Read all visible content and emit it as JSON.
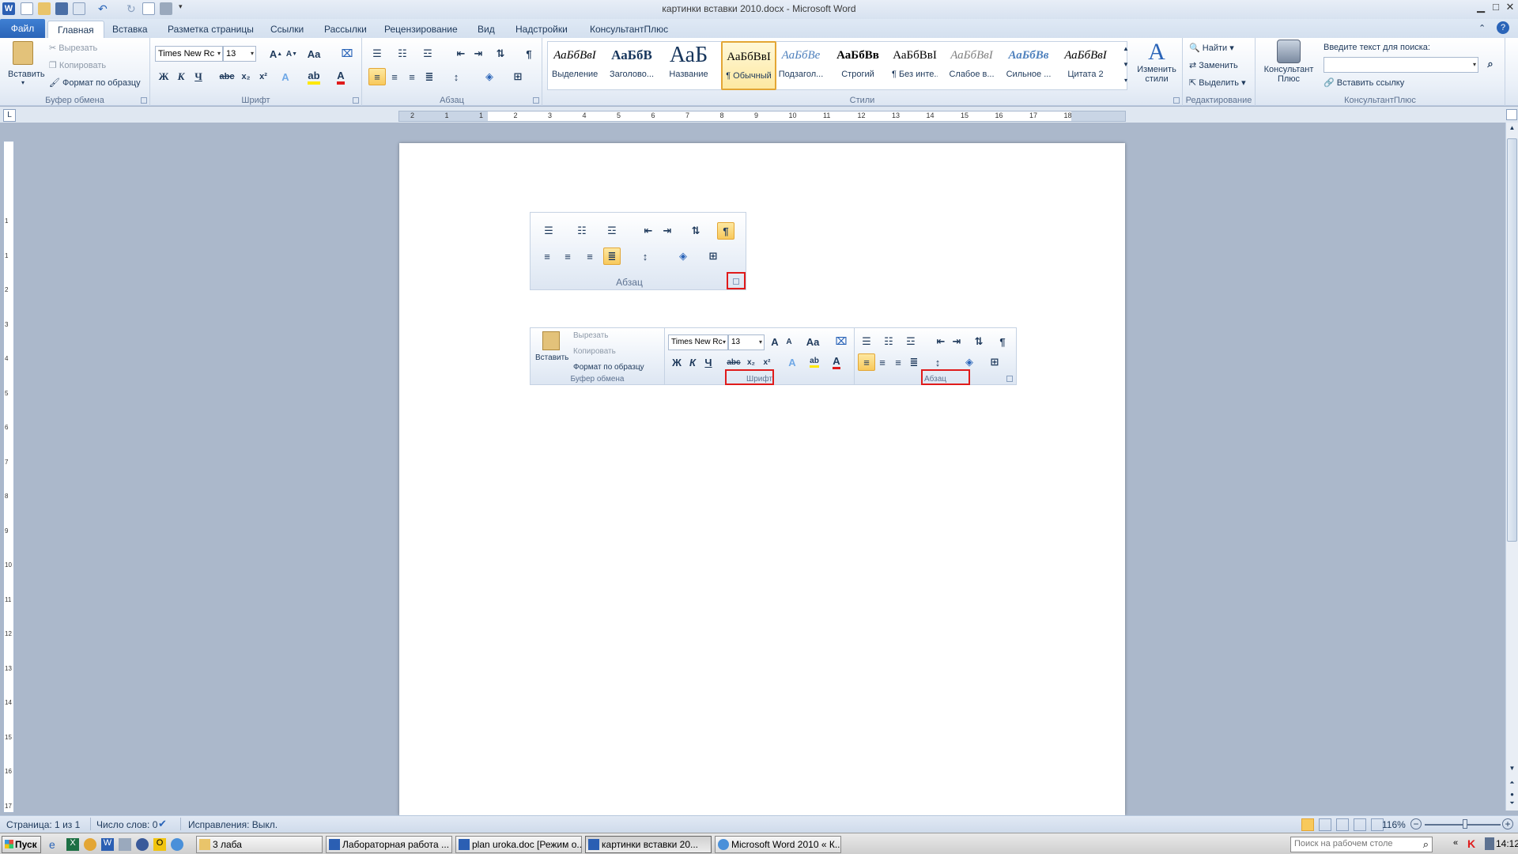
{
  "window": {
    "title": "картинки вставки 2010.docx - Microsoft Word"
  },
  "tabs": {
    "file": "Файл",
    "items": [
      "Главная",
      "Вставка",
      "Разметка страницы",
      "Ссылки",
      "Рассылки",
      "Рецензирование",
      "Вид",
      "Надстройки",
      "КонсультантПлюс"
    ]
  },
  "ribbon": {
    "clipboard": {
      "paste": "Вставить",
      "cut": "Вырезать",
      "copy": "Копировать",
      "format_painter": "Формат по образцу",
      "label": "Буфер обмена"
    },
    "font": {
      "name": "Times New Rc",
      "size": "13",
      "label": "Шрифт"
    },
    "paragraph": {
      "label": "Абзац"
    },
    "styles": {
      "label": "Стили",
      "items": [
        {
          "preview": "АаБбВвІ",
          "label": "Выделение"
        },
        {
          "preview": "АаБбВ",
          "label": "Заголово..."
        },
        {
          "preview": "АаБ",
          "label": "Название"
        },
        {
          "preview": "АаБбВвІ",
          "label": "¶ Обычный"
        },
        {
          "preview": "АаБбВе",
          "label": "Подзагол..."
        },
        {
          "preview": "АаБбВв",
          "label": "Строгий"
        },
        {
          "preview": "АаБбВвІ",
          "label": "¶ Без инте..."
        },
        {
          "preview": "АаБбВвІ",
          "label": "Слабое в..."
        },
        {
          "preview": "АаБбВв",
          "label": "Сильное ..."
        },
        {
          "preview": "АаБбВвІ",
          "label": "Цитата 2"
        }
      ],
      "change_styles": "Изменить стили"
    },
    "editing": {
      "find": "Найти",
      "replace": "Заменить",
      "select": "Выделить",
      "label": "Редактирование"
    },
    "consultant": {
      "button": "Консультант Плюс",
      "search_label": "Введите текст для поиска:",
      "insert_link": "Вставить ссылку",
      "label": "КонсультантПлюс"
    }
  },
  "ruler": {
    "marks": [
      "2",
      "1",
      "1",
      "2",
      "3",
      "4",
      "5",
      "6",
      "7",
      "8",
      "9",
      "10",
      "11",
      "12",
      "13",
      "14",
      "15",
      "16",
      "17",
      "18"
    ]
  },
  "vruler": {
    "marks": [
      "1",
      "1",
      "2",
      "3",
      "4",
      "5",
      "6",
      "7",
      "8",
      "9",
      "10",
      "11",
      "12",
      "13",
      "14",
      "15",
      "16",
      "17"
    ]
  },
  "document": {
    "image1": {
      "label": "Абзац"
    },
    "image2": {
      "paste": "Вставить",
      "cut": "Вырезать",
      "copy": "Копировать",
      "format_painter": "Формат по образцу",
      "clipboard_label": "Буфер обмена",
      "font_name": "Times New Rc",
      "font_size": "13",
      "font_label": "Шрифт",
      "paragraph_label": "Абзац"
    }
  },
  "status": {
    "page": "Страница: 1 из 1",
    "words": "Число слов: 0",
    "track": "Исправления: Выкл.",
    "zoom": "116%"
  },
  "taskbar": {
    "start": "Пуск",
    "buttons": [
      "3 лаба",
      "Лабораторная работа ...",
      "plan uroka.doc [Режим о...",
      "картинки вставки 20...",
      "Microsoft Word 2010 « К..."
    ],
    "search_placeholder": "Поиск на рабочем столе",
    "clock": "14:12"
  },
  "colors": {
    "accent": "#2a64b8",
    "highlight": "#f8c95c",
    "red_box": "#e01b1b"
  }
}
